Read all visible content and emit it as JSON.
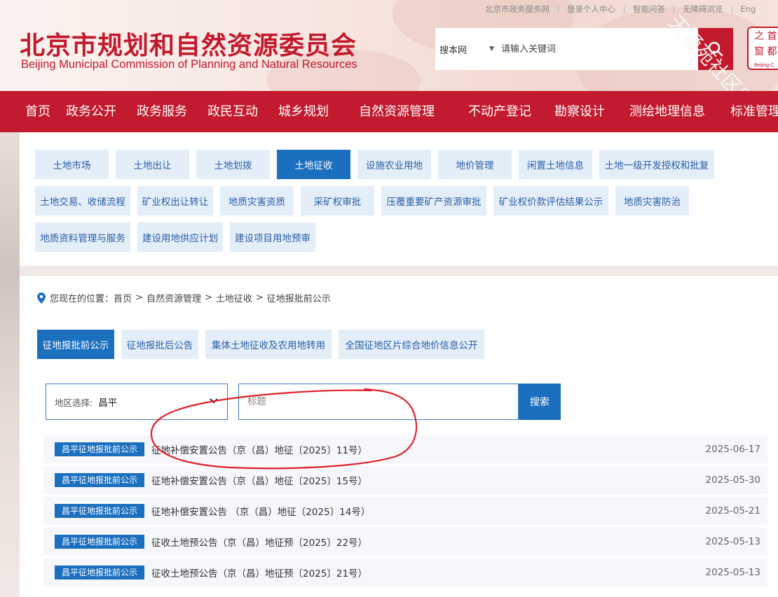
{
  "top_links": [
    "北京市政务服务网",
    "登录个人中心",
    "智能问答",
    "无障碍浏览",
    "Eng"
  ],
  "logo": {
    "cn": "北京市规划和自然资源委员会",
    "en": "Beijing Municipal Commission of Planning and Natural Resources"
  },
  "search": {
    "scope": "搜本网",
    "placeholder": "请输入关键词"
  },
  "seal": {
    "line1": "之 首",
    "line2": "窗 都",
    "small": "Beijing-C"
  },
  "watermark": "天通苑社区网",
  "nav": [
    "首页",
    "政务公开",
    "政务服务",
    "政民互动",
    "城乡规划",
    "自然资源管理",
    "不动产登记",
    "勘察设计",
    "测绘地理信息",
    "标准管理"
  ],
  "categories": [
    "土地市场",
    "土地出让",
    "土地划拨",
    "土地征收",
    "设施农业用地",
    "地价管理",
    "闲置土地信息",
    "土地一级开发授权和批复",
    "土地交易、收储流程",
    "矿业权出让转让",
    "地质灾害资质",
    "采矿权审批",
    "压覆重要矿产资源审批",
    "矿业权价款评估结果公示",
    "地质灾害防治",
    "地质资料管理与服务",
    "建设用地供应计划",
    "建设项目用地预审"
  ],
  "active_category": "土地征收",
  "breadcrumb": {
    "prefix": "您现在的位置：",
    "items": [
      "首页",
      "自然资源管理",
      "土地征收",
      "征地报批前公示"
    ],
    "sep": ">"
  },
  "sub_tabs": [
    "征地报批前公示",
    "征地报批后公告",
    "集体土地征收及农用地转用",
    "全国征地区片综合地价信息公开"
  ],
  "filter": {
    "region_label": "地区选择:",
    "region_value": "昌平",
    "title_placeholder": "标题",
    "search_label": "搜索"
  },
  "rows": [
    {
      "badge": "昌平征地报批前公示",
      "title": "征地补偿安置公告（京（昌）地征〔2025〕11号）",
      "date": "2025-06-17"
    },
    {
      "badge": "昌平征地报批前公示",
      "title": "征地补偿安置公告（京（昌）地征〔2025〕15号）",
      "date": "2025-05-30"
    },
    {
      "badge": "昌平征地报批前公示",
      "title": "征地补偿安置公告 （京（昌）地征〔2025〕14号）",
      "date": "2025-05-21"
    },
    {
      "badge": "昌平征地报批前公示",
      "title": "征收土地预公告（京（昌）地征预〔2025〕22号）",
      "date": "2025-05-13"
    },
    {
      "badge": "昌平征地报批前公示",
      "title": "征收土地预公告（京（昌）地征预〔2025〕21号）",
      "date": "2025-05-13"
    }
  ],
  "colors": {
    "brand_red": "#c21a2e",
    "accent_blue": "#1b6fbf",
    "tab_bg": "#e4eef9",
    "annotation_red": "#e0202a"
  }
}
